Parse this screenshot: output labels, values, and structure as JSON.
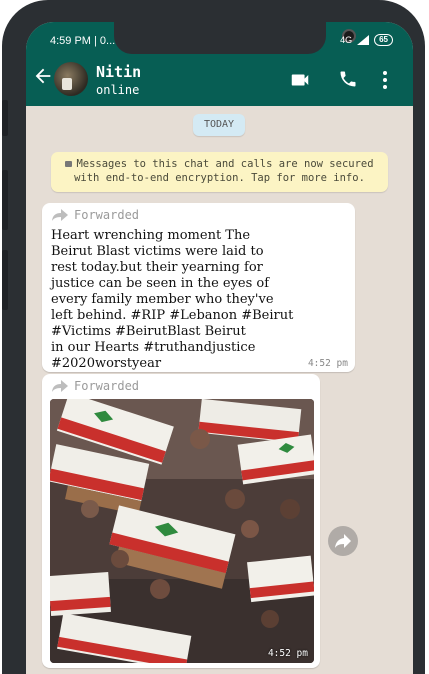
{
  "status_bar": {
    "time": "4:59 PM | 0...",
    "network": "4G",
    "battery": "65"
  },
  "header": {
    "contact_name": "Nitin",
    "contact_status": "online"
  },
  "chat": {
    "date_chip": "TODAY",
    "encryption_notice": "Messages to this chat and calls are now secured\nwith end-to-end encryption. Tap for more info.",
    "messages": [
      {
        "forwarded_label": "Forwarded",
        "text": "Heart wrenching moment The\nBeirut Blast victims were laid to\nrest today.but their yearning for\njustice can be seen in the eyes of\nevery family member who they've\nleft behind. #RIP #Lebanon #Beirut\n#Victims #BeirutBlast Beirut\nin our Hearts #truthandjustice\n#2020worstyear",
        "time": "4:52 pm"
      },
      {
        "forwarded_label": "Forwarded",
        "time": "4:52 pm"
      }
    ]
  },
  "icons": {
    "back": "arrow-left-icon",
    "video": "video-camera-icon",
    "call": "phone-icon",
    "menu": "more-vert-icon",
    "forward": "forward-arrow-icon",
    "share": "share-forward-icon"
  },
  "colors": {
    "header": "#075e54",
    "chat_background": "#e5ddd5",
    "notice_background": "#fcf4c4",
    "date_chip_background": "#d4eaf4"
  }
}
